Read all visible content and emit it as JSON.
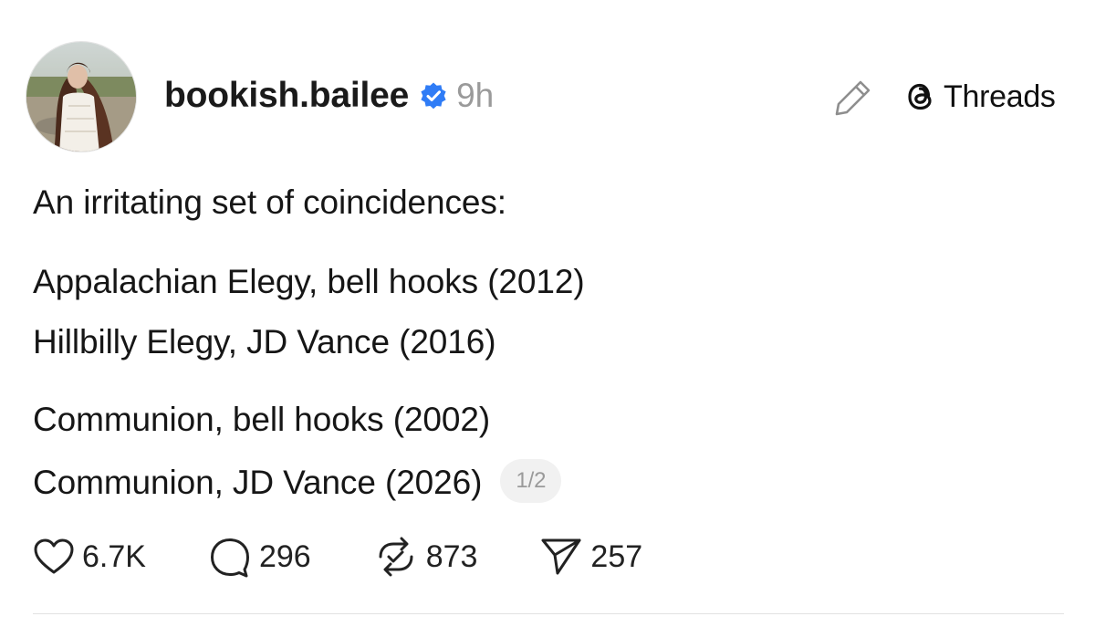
{
  "post": {
    "username": "bookish.bailee",
    "timestamp": "9h",
    "verified": true,
    "brand_name": "Threads",
    "lines": [
      "An irritating set of coincidences:",
      "Appalachian Elegy, bell hooks (2012)",
      "Hillbilly Elegy, JD Vance (2016)",
      "Communion, bell hooks (2002)",
      "Communion, JD Vance (2026)"
    ],
    "page_indicator": "1/2",
    "actions": {
      "likes": "6.7K",
      "replies": "296",
      "reposts": "873",
      "shares": "257"
    }
  },
  "icons": {
    "edit": "pencil-icon",
    "brand": "threads-logo-icon",
    "verified": "verified-badge-icon",
    "like": "heart-icon",
    "reply": "comment-icon",
    "repost": "repost-icon",
    "share": "send-icon"
  },
  "colors": {
    "verified_blue": "#2f7cf6",
    "muted_text": "#9a9a9a",
    "primary_text": "#161616"
  }
}
